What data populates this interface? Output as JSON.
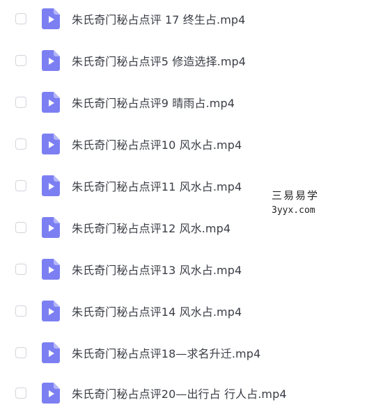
{
  "files": [
    {
      "name": "朱氏奇门秘占点评 17 终生占.mp4"
    },
    {
      "name": "朱氏奇门秘占点评5 修造选择.mp4"
    },
    {
      "name": "朱氏奇门秘占点评9 晴雨占.mp4"
    },
    {
      "name": "朱氏奇门秘占点评10 风水占.mp4"
    },
    {
      "name": "朱氏奇门秘占点评11 风水占.mp4"
    },
    {
      "name": "朱氏奇门秘占点评12 风水.mp4"
    },
    {
      "name": "朱氏奇门秘占点评13 风水占.mp4"
    },
    {
      "name": "朱氏奇门秘占点评14 风水占.mp4"
    },
    {
      "name": "朱氏奇门秘占点评18—求名升迁.mp4"
    },
    {
      "name": "朱氏奇门秘占点评20—出行占 行人占.mp4"
    }
  ],
  "watermark": {
    "line1": "三易易学",
    "line2": "3yyx.com"
  },
  "colors": {
    "icon": "#7c7ff2",
    "text": "#3a3d45",
    "checkbox_border": "#d2d4da"
  },
  "file_icon": "video-file-icon"
}
